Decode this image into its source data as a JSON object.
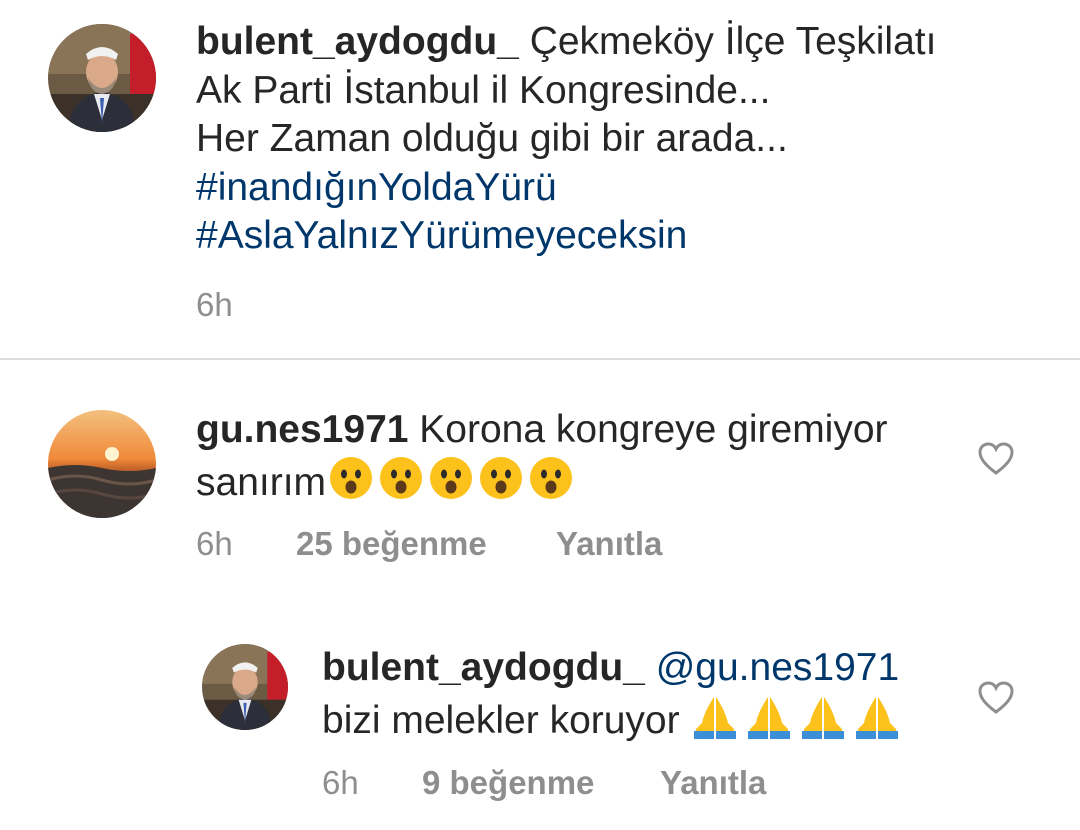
{
  "caption": {
    "username": "bulent_aydogdu_",
    "line1": "Çekmeköy İlçe Teşkilatı",
    "line2": "Ak Parti İstanbul il Kongresinde...",
    "line3": "Her Zaman olduğu gibi bir arada...",
    "hashtag1": "#inandığınYoldaYürü",
    "hashtag2": "#AslaYalnızYürümeyeceksin",
    "time": "6h"
  },
  "comment1": {
    "username": "gu.nes1971",
    "text_line1": "Korona kongreye giremiyor",
    "text_line2": "sanırım",
    "emoji_name": "hushed-face-emoji",
    "emoji_count": 5,
    "time": "6h",
    "likes": "25 beğenme",
    "reply": "Yanıtla"
  },
  "reply1": {
    "username": "bulent_aydogdu_",
    "mention": "@gu.nes1971",
    "text": "bizi melekler koruyor",
    "emoji_name": "folded-hands-emoji",
    "emoji_count": 4,
    "time": "6h",
    "likes": "9 beğenme",
    "reply": "Yanıtla"
  },
  "colors": {
    "text": "#262626",
    "muted": "#8e8e8e",
    "link": "#00376b",
    "divider": "#dbdbdb"
  }
}
